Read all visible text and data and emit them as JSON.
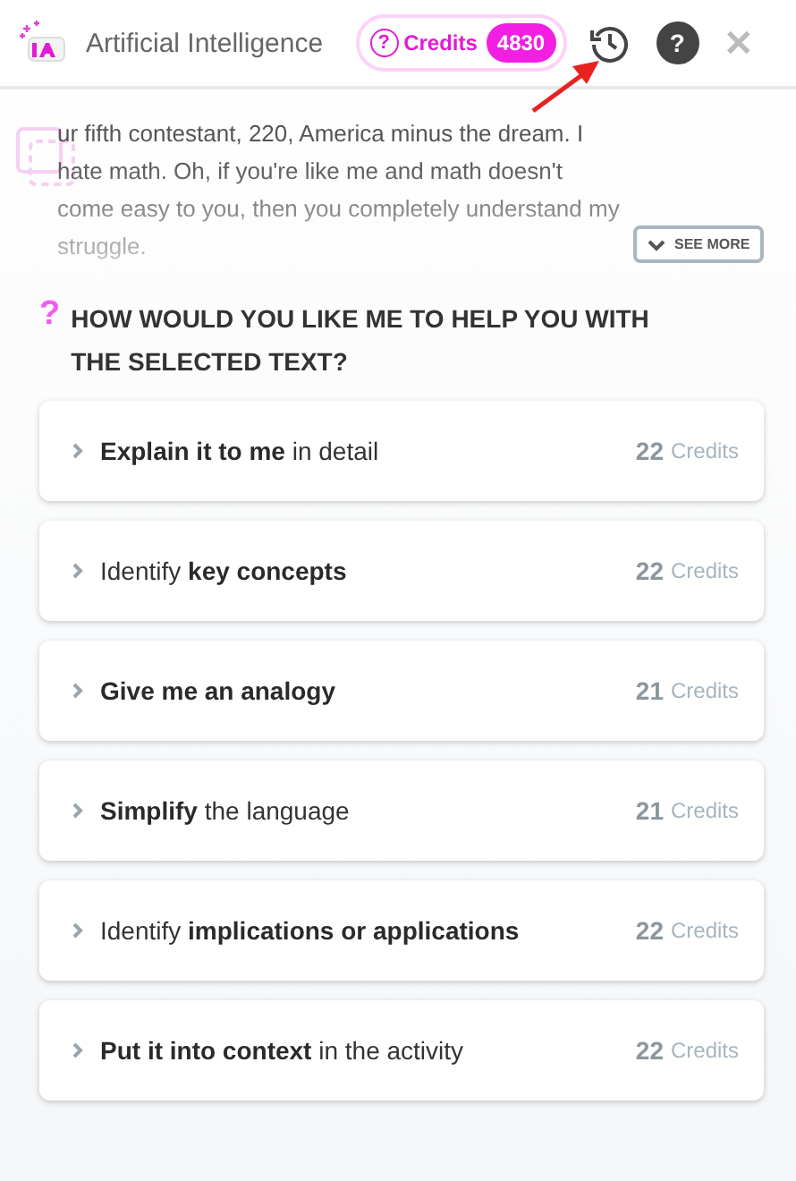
{
  "header": {
    "title": "Artificial Intelligence",
    "credits_label": "Credits",
    "credits_count": "4830",
    "help_glyph": "?",
    "close_glyph": "✕"
  },
  "excerpt": {
    "text": "ur fifth contestant, 220, America minus the dream. I hate math. Oh, if you're like me and math doesn't come easy to you, then you completely understand my struggle.",
    "see_more": "SEE MORE"
  },
  "prompt": {
    "icon_glyph": "?",
    "heading": "HOW WOULD YOU LIKE ME TO HELP YOU WITH THE SELECTED TEXT?"
  },
  "options": [
    {
      "label": "**Explain it to me** in detail",
      "cost": "22",
      "unit": "Credits"
    },
    {
      "label": "Identify **key concepts**",
      "cost": "22",
      "unit": "Credits"
    },
    {
      "label": "**Give me an analogy**",
      "cost": "21",
      "unit": "Credits"
    },
    {
      "label": "**Simplify** the language",
      "cost": "21",
      "unit": "Credits"
    },
    {
      "label": "Identify **implications or applications**",
      "cost": "22",
      "unit": "Credits"
    },
    {
      "label": "**Put it into context** in the activity",
      "cost": "22",
      "unit": "Credits"
    }
  ]
}
